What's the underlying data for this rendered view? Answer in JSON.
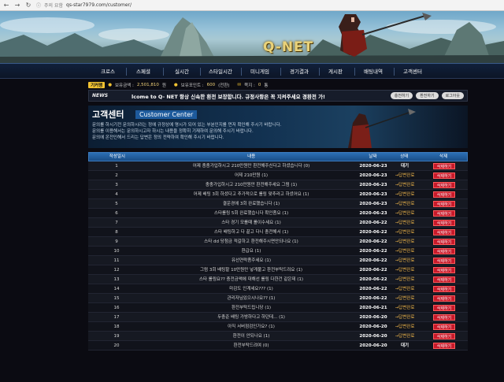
{
  "browser": {
    "url": "qs-star7979.com/customer/",
    "warning": "주의 요함"
  },
  "site": {
    "logo": "Q-NET",
    "colors": {
      "accent": "#f1c232",
      "header": "#1a4e87",
      "delete": "#c81a2b"
    }
  },
  "nav": {
    "items": [
      "크로스",
      "스페셜",
      "실시간",
      "스타일시간",
      "미니게임",
      "경기결과",
      "게시판",
      "배팅내역",
      "고객센터"
    ]
  },
  "infobar": {
    "tag": "기커랭",
    "point_label": "보유금액 :",
    "point_value": "2,501,810",
    "point_unit": "원",
    "bonus_label": "보유포인트 :",
    "bonus_value": "600",
    "bonus_unit": "(전환)",
    "note_label": "쪽지 :",
    "note_value": "0",
    "note_unit": "통"
  },
  "newsbar": {
    "label": "NEWS",
    "text": "lcome to Q- NET 항상 신속한 환전 보장합니다. 규정사항은 꼭 지켜주세요 경환전 가!",
    "buttons": [
      "충전하기",
      "환전하기",
      "로그아웃"
    ]
  },
  "customer_center": {
    "title": "고객센터",
    "subtitle": "Customer Center",
    "desc_lines": [
      "문의를 하시기전 문의하시려는 정에 규정상에 명시가 되어 있는 부분인지를 먼저 확인해 주시기 바랍니다.",
      "문의를 이용해서는 문의하시고자 하시는 내용을 정확히 기재하여 문의해 주시기 바랍니다.",
      "문의에 온전인해서 드리는 답변은 정의 전략하여 확인해 주시기 바랍니다."
    ]
  },
  "table": {
    "headers": [
      "작성일시",
      "내용",
      "날짜",
      "상태",
      "삭제"
    ],
    "delete_label": "삭제하기",
    "rows": [
      {
        "no": "1",
        "content": "어제 충충가입하시고 210만원만 환전해주신다고 하셨습니다 (0)",
        "date": "2020-06-23",
        "status": "대기"
      },
      {
        "no": "2",
        "content": "어제 210만원 (1)",
        "date": "2020-06-23",
        "status": "→답변완료"
      },
      {
        "no": "3",
        "content": "충충가입하시고 210만원만 환전해주세요 그럼 (1)",
        "date": "2020-06-23",
        "status": "→답변완료"
      },
      {
        "no": "4",
        "content": "어제 배팅 3회 하셨다고 추가적으로 롤링 맞추라고 하셨어요 (1)",
        "date": "2020-06-23",
        "status": "→답변완료"
      },
      {
        "no": "5",
        "content": "결운경에 3회 완료했습니다 (1)",
        "date": "2020-06-23",
        "status": "→답변완료"
      },
      {
        "no": "6",
        "content": "스타롤링 5회 완료했습니다 확인좀요 (1)",
        "date": "2020-06-23",
        "status": "→답변완료"
      },
      {
        "no": "7",
        "content": "스타 경기 모를때 롤이수세요 (1)",
        "date": "2020-06-22",
        "status": "→답변완료"
      },
      {
        "no": "8",
        "content": "스타 배팅하고 다 끝고 다니 충전해서 (1)",
        "date": "2020-06-22",
        "status": "→답변완료"
      },
      {
        "no": "9",
        "content": "스타 dd 당첨금 적갈하고 환전해주시면안되나요 (1)",
        "date": "2020-06-22",
        "status": "→답변완료"
      },
      {
        "no": "10",
        "content": "환급요 (1)",
        "date": "2020-06-22",
        "status": "→답변완료"
      },
      {
        "no": "11",
        "content": "유선연락좀주세요 (1)",
        "date": "2020-06-22",
        "status": "→답변완료"
      },
      {
        "no": "12",
        "content": "그럼 3회 배팅할 10만원만 넣게불고 환전부탁드려요 (1)",
        "date": "2020-06-22",
        "status": "→답변완료"
      },
      {
        "no": "13",
        "content": "스타 롤링요?? 충전금액에 대해선 롤링 다한건 같은데 (1)",
        "date": "2020-06-22",
        "status": "→답변완료"
      },
      {
        "no": "14",
        "content": "마감도 인계세요??? (1)",
        "date": "2020-06-22",
        "status": "→답변완료"
      },
      {
        "no": "15",
        "content": "관리자님있으시나요?? (1)",
        "date": "2020-06-22",
        "status": "→답변완료"
      },
      {
        "no": "16",
        "content": "환전부탁드립니당 (1)",
        "date": "2020-06-21",
        "status": "→답변완료"
      },
      {
        "no": "17",
        "content": "두충준 배팅 가방하다고 하던데... (1)",
        "date": "2020-06-20",
        "status": "→답변완료"
      },
      {
        "no": "18",
        "content": "아직 서버점검인가요? (1)",
        "date": "2020-06-20",
        "status": "→답변완료"
      },
      {
        "no": "19",
        "content": "환전이 안되나요 (1)",
        "date": "2020-06-20",
        "status": "→답변완료"
      },
      {
        "no": "20",
        "content": "환전부탁드려여 (0)",
        "date": "2020-06-20",
        "status": "대기"
      }
    ]
  }
}
